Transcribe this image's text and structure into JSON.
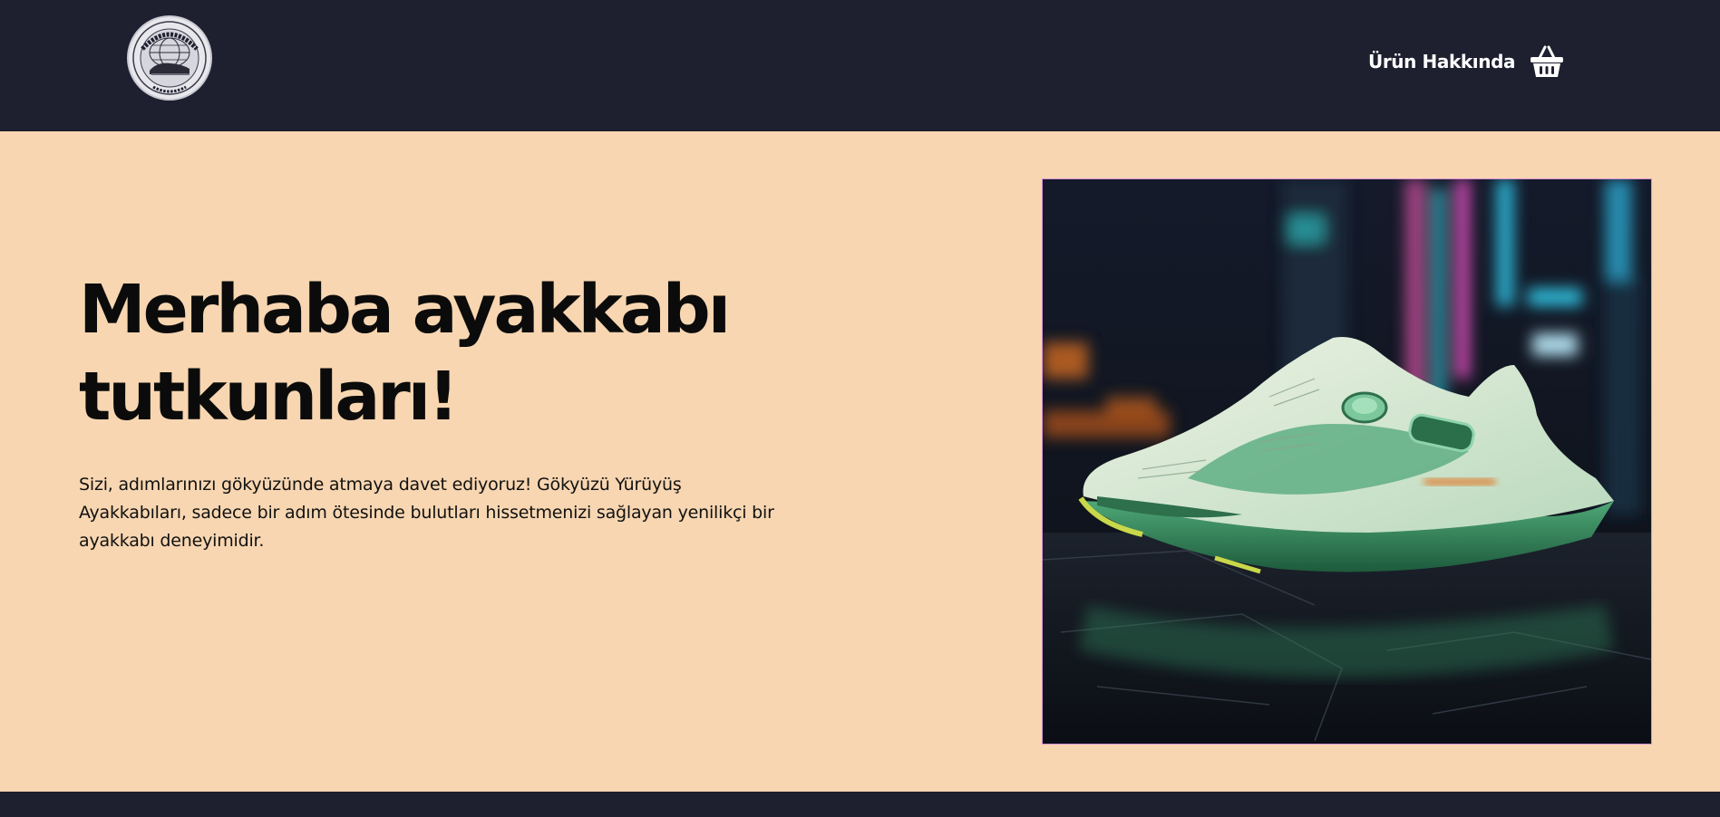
{
  "header": {
    "logo_icon": "brand-seal-logo",
    "logo_text": "LUMINOVITDE OF FUTURE",
    "nav": {
      "about_label": "Ürün Hakkında"
    },
    "cart_icon": "shopping-basket-icon"
  },
  "hero": {
    "title": "Merhaba ayakkabı tutkunları!",
    "description": "Sizi, adımlarınızı gökyüzünde atmaya davet ediyoruz! Gökyüzü Yürüyüş Ayakkabıları, sadece bir adım ötesinde bulutları hissetmenizi sağlayan yenilikçi bir ayakkabı deneyimidir.",
    "image_icon": "futuristic-sneaker-image"
  },
  "colors": {
    "header_bg": "#1e1f2f",
    "hero_bg": "#f7d6b1",
    "text_dark": "#0b0b0b",
    "image_border": "#d98fd8"
  }
}
